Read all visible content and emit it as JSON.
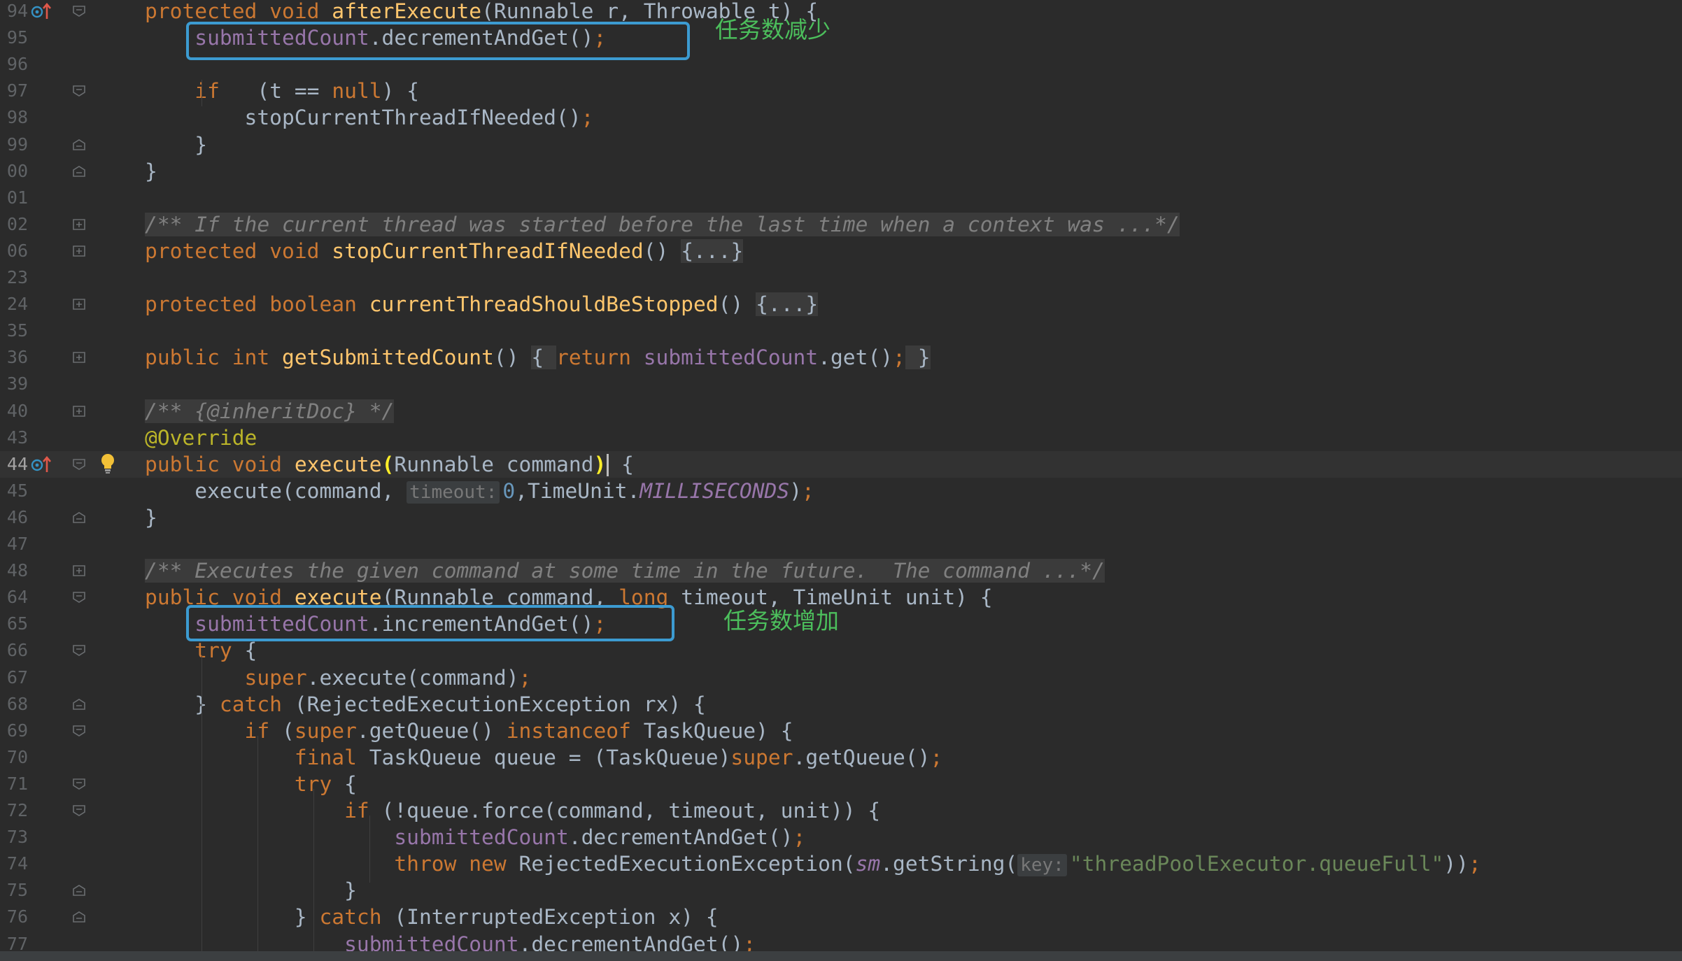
{
  "lines": [
    {
      "n": "94",
      "marker": "override",
      "fold": "open",
      "tokens": [
        [
          "kw",
          "protected"
        ],
        [
          "",
          "&nbsp;"
        ],
        [
          "kw",
          "void"
        ],
        [
          "",
          "&nbsp;"
        ],
        [
          "fnd",
          "afterExecute"
        ],
        [
          "",
          "(Runnable r, Throwable t) {"
        ]
      ]
    },
    {
      "n": "95",
      "fold": "none",
      "tokens": [
        [
          "",
          "    "
        ],
        [
          "fld",
          "submittedCount"
        ],
        [
          "",
          ".decrementAndGet()"
        ],
        [
          "kw",
          ";"
        ]
      ]
    },
    {
      "n": "96",
      "fold": "none",
      "tokens": []
    },
    {
      "n": "97",
      "fold": "open",
      "tokens": [
        [
          "",
          "    "
        ],
        [
          "kw",
          "if"
        ],
        [
          "",
          ""
        ],
        [
          "",
          ""
        ],
        [
          "",
          ""
        ],
        [
          "",
          "(t == "
        ],
        [
          "kw",
          "null"
        ],
        [
          "",
          ") {"
        ]
      ]
    },
    {
      "n": "98",
      "fold": "none",
      "tokens": [
        [
          "",
          "        stopCurrentThreadIfNeeded()"
        ],
        [
          "kw",
          ";"
        ]
      ]
    },
    {
      "n": "99",
      "fold": "close",
      "tokens": [
        [
          "",
          "    }"
        ]
      ]
    },
    {
      "n": "00",
      "fold": "close",
      "tokens": [
        [
          "",
          "}"
        ]
      ]
    },
    {
      "n": "01",
      "fold": "none",
      "tokens": []
    },
    {
      "n": "02",
      "fold": "plus",
      "tokens": [
        [
          "cmt fb",
          "/** If the current thread was started before the last time when a context was ...*/"
        ]
      ]
    },
    {
      "n": "06",
      "fold": "plus",
      "tokens": [
        [
          "kw",
          "protected"
        ],
        [
          "",
          ""
        ],
        [
          "kw",
          "void"
        ],
        [
          "",
          ""
        ],
        [
          "fnd",
          "stopCurrentThreadIfNeeded"
        ],
        [
          "",
          "() "
        ],
        [
          "fb",
          "{...}"
        ]
      ]
    },
    {
      "n": "23",
      "fold": "none",
      "tokens": []
    },
    {
      "n": "24",
      "fold": "plus",
      "tokens": [
        [
          "kw",
          "protected"
        ],
        [
          "",
          ""
        ],
        [
          "kw",
          "boolean"
        ],
        [
          "",
          ""
        ],
        [
          "fnd",
          "currentThreadShouldBeStopped"
        ],
        [
          "",
          "() "
        ],
        [
          "fb",
          "{...}"
        ]
      ]
    },
    {
      "n": "35",
      "fold": "none",
      "tokens": []
    },
    {
      "n": "36",
      "fold": "plus",
      "tokens": [
        [
          "kw",
          "public"
        ],
        [
          "",
          ""
        ],
        [
          "kw",
          "int"
        ],
        [
          "",
          ""
        ],
        [
          "fnd",
          "getSubmittedCount"
        ],
        [
          "",
          "() "
        ],
        [
          "fb",
          "{ "
        ],
        [
          "kw",
          "return"
        ],
        [
          "",
          ""
        ],
        [
          "fld",
          "submittedCount"
        ],
        [
          "",
          ".get()"
        ],
        [
          "kw",
          ";"
        ],
        [
          "fb",
          " }"
        ]
      ]
    },
    {
      "n": "39",
      "fold": "none",
      "tokens": []
    },
    {
      "n": "40",
      "fold": "plus",
      "tokens": [
        [
          "cmt fb",
          "/** {@inheritDoc} */"
        ]
      ]
    },
    {
      "n": "43",
      "fold": "none",
      "tokens": [
        [
          "ann",
          "@Override"
        ]
      ]
    },
    {
      "n": "44",
      "marker": "override",
      "fold": "open",
      "bulb": true,
      "current": true,
      "tokens": [
        [
          "kw",
          "public"
        ],
        [
          "",
          ""
        ],
        [
          "kw",
          "void"
        ],
        [
          "",
          ""
        ],
        [
          "fnd",
          "execute"
        ],
        [
          "brm",
          "("
        ],
        [
          "",
          "Runnable command"
        ],
        [
          "brm",
          ")"
        ],
        [
          "caret",
          ""
        ],
        [
          "",
          " {"
        ]
      ]
    },
    {
      "n": "45",
      "fold": "none",
      "tokens": [
        [
          "",
          "    execute(command, "
        ],
        [
          "hint",
          "timeout:"
        ],
        [
          "num",
          "0"
        ],
        [
          "",
          ",TimeUnit."
        ],
        [
          "fldi",
          "MILLISECONDS"
        ],
        [
          "",
          ")"
        ],
        [
          "kw",
          ";"
        ]
      ]
    },
    {
      "n": "46",
      "fold": "close",
      "tokens": [
        [
          "",
          "}"
        ]
      ]
    },
    {
      "n": "47",
      "fold": "none",
      "tokens": []
    },
    {
      "n": "48",
      "fold": "plus",
      "tokens": [
        [
          "cmt fb",
          "/** Executes the given command at some time in the future.  The command ...*/"
        ]
      ]
    },
    {
      "n": "64",
      "fold": "open",
      "tokens": [
        [
          "kw",
          "public"
        ],
        [
          "",
          ""
        ],
        [
          "kw",
          "void"
        ],
        [
          "",
          ""
        ],
        [
          "fnd",
          "execute"
        ],
        [
          "",
          "(Runnable command, "
        ],
        [
          "kw",
          "long"
        ],
        [
          "",
          " timeout, TimeUnit unit) {"
        ]
      ]
    },
    {
      "n": "65",
      "fold": "none",
      "tokens": [
        [
          "",
          "    "
        ],
        [
          "fld",
          "submittedCount"
        ],
        [
          "",
          ".incrementAndGet()"
        ],
        [
          "kw",
          ";"
        ]
      ]
    },
    {
      "n": "66",
      "fold": "open",
      "tokens": [
        [
          "",
          "    "
        ],
        [
          "kw",
          "try"
        ],
        [
          "",
          " {"
        ]
      ]
    },
    {
      "n": "67",
      "fold": "none",
      "tokens": [
        [
          "",
          "        "
        ],
        [
          "kw",
          "super"
        ],
        [
          "",
          ".execute(command)"
        ],
        [
          "kw",
          ";"
        ]
      ]
    },
    {
      "n": "68",
      "fold": "close",
      "tokens": [
        [
          "",
          "    } "
        ],
        [
          "kw",
          "catch"
        ],
        [
          "",
          " (RejectedExecutionException rx) {"
        ]
      ]
    },
    {
      "n": "69",
      "fold": "open",
      "tokens": [
        [
          "",
          "        "
        ],
        [
          "kw",
          "if"
        ],
        [
          "",
          " ("
        ],
        [
          "kw",
          "super"
        ],
        [
          "",
          ".getQueue() "
        ],
        [
          "kw",
          "instanceof"
        ],
        [
          "",
          " TaskQueue) {"
        ]
      ]
    },
    {
      "n": "70",
      "fold": "none",
      "tokens": [
        [
          "",
          "            "
        ],
        [
          "kw",
          "final"
        ],
        [
          "",
          " TaskQueue queue = (TaskQueue)"
        ],
        [
          "kw",
          "super"
        ],
        [
          "",
          ".getQueue()"
        ],
        [
          "kw",
          ";"
        ]
      ]
    },
    {
      "n": "71",
      "fold": "open",
      "tokens": [
        [
          "",
          "            "
        ],
        [
          "kw",
          "try"
        ],
        [
          "",
          " {"
        ]
      ]
    },
    {
      "n": "72",
      "fold": "open",
      "tokens": [
        [
          "",
          "                "
        ],
        [
          "kw",
          "if"
        ],
        [
          "",
          " (!queue.force(command, timeout, unit)) {"
        ]
      ]
    },
    {
      "n": "73",
      "fold": "none",
      "tokens": [
        [
          "",
          "                    "
        ],
        [
          "fld",
          "submittedCount"
        ],
        [
          "",
          ".decrementAndGet()"
        ],
        [
          "kw",
          ";"
        ]
      ]
    },
    {
      "n": "74",
      "fold": "none",
      "tokens": [
        [
          "",
          "                    "
        ],
        [
          "kw",
          "throw new"
        ],
        [
          "",
          " RejectedExecutionException("
        ],
        [
          "fldi",
          "sm"
        ],
        [
          "",
          ".getString("
        ],
        [
          "hint",
          "key:"
        ],
        [
          "str",
          "\"threadPoolExecutor.queueFull\""
        ],
        [
          "",
          "))"
        ],
        [
          "kw",
          ";"
        ]
      ]
    },
    {
      "n": "75",
      "fold": "close",
      "tokens": [
        [
          "",
          "                }"
        ]
      ]
    },
    {
      "n": "76",
      "fold": "close",
      "tokens": [
        [
          "",
          "            } "
        ],
        [
          "kw",
          "catch"
        ],
        [
          "",
          " (InterruptedException x) {"
        ]
      ]
    },
    {
      "n": "77",
      "fold": "none",
      "tokens": [
        [
          "",
          "                "
        ],
        [
          "fld",
          "submittedCount"
        ],
        [
          "",
          ".decrementAndGet()"
        ],
        [
          "kw",
          ";"
        ]
      ]
    }
  ],
  "annotations": {
    "decrease": "任务数减少",
    "increase": "任务数增加"
  },
  "colors": {
    "background": "#2b2b2b",
    "keyword": "#cc7832",
    "method_decl": "#ffc66d",
    "field": "#9876aa",
    "number": "#6897bb",
    "string": "#6a8759",
    "annotation_box": "#3c9bd1",
    "annotation_text": "#4cbf5c"
  }
}
